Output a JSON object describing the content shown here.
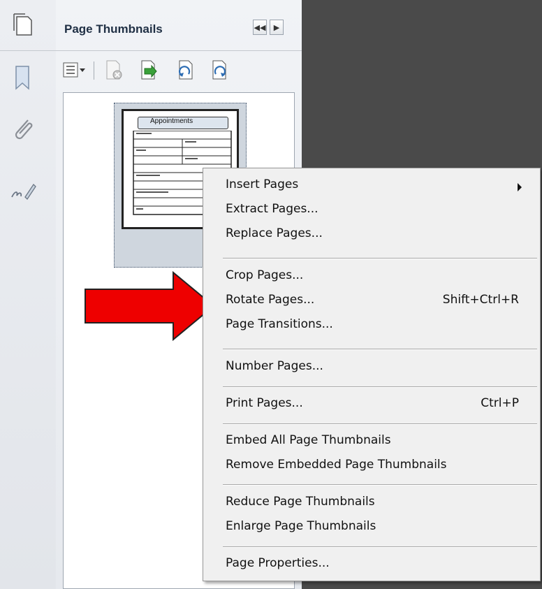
{
  "panel": {
    "title": "Page Thumbnails"
  },
  "thumbnail": {
    "page_heading": "Appointments"
  },
  "menu": {
    "items": [
      {
        "label": "Insert Pages",
        "shortcut": ""
      },
      {
        "label": "Extract Pages...",
        "shortcut": ""
      },
      {
        "label": "Replace Pages...",
        "shortcut": ""
      },
      {
        "label": "Crop Pages...",
        "shortcut": ""
      },
      {
        "label": "Rotate Pages...",
        "shortcut": "Shift+Ctrl+R"
      },
      {
        "label": "Page Transitions...",
        "shortcut": ""
      },
      {
        "label": "Number Pages...",
        "shortcut": ""
      },
      {
        "label": "Print Pages...",
        "shortcut": "Ctrl+P"
      },
      {
        "label": "Embed All Page Thumbnails",
        "shortcut": ""
      },
      {
        "label": "Remove Embedded Page Thumbnails",
        "shortcut": ""
      },
      {
        "label": "Reduce Page Thumbnails",
        "shortcut": ""
      },
      {
        "label": "Enlarge Page Thumbnails",
        "shortcut": ""
      },
      {
        "label": "Page Properties...",
        "shortcut": ""
      }
    ]
  },
  "icons": {
    "rail": [
      "pages-icon",
      "bookmark-icon",
      "attachment-icon",
      "signature-icon"
    ],
    "toolbar": [
      "options-menu-icon",
      "delete-page-icon",
      "insert-page-icon",
      "undo-rotate-icon",
      "rotate-icon"
    ]
  },
  "colors": {
    "highlight_arrow": "#ee0000",
    "workspace": "#4a4a4a",
    "menu_bg": "#f0f0f0"
  }
}
